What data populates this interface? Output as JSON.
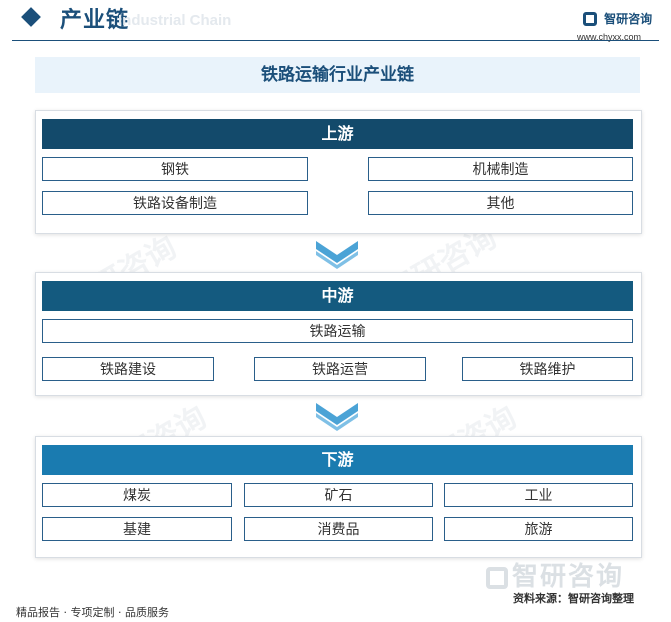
{
  "header": {
    "section_title": "产业链",
    "section_subtitle": "Industrial Chain",
    "brand_name": "智研咨询",
    "brand_url": "www.chyxx.com"
  },
  "title": "铁路运输行业产业链",
  "upstream": {
    "label": "上游",
    "items": [
      "钢铁",
      "机械制造",
      "铁路设备制造",
      "其他"
    ]
  },
  "midstream": {
    "label": "中游",
    "core": "铁路运输",
    "items": [
      "铁路建设",
      "铁路运营",
      "铁路维护"
    ]
  },
  "downstream": {
    "label": "下游",
    "items": [
      "煤炭",
      "矿石",
      "工业",
      "基建",
      "消费品",
      "旅游"
    ]
  },
  "footer": {
    "left": "精品报告 · 专项定制 · 品质服务",
    "source": "资料来源：智研咨询整理",
    "watermark": "智研咨询"
  },
  "colors": {
    "upstream_bar": "#134a6b",
    "midstream_bar": "#145a7f",
    "downstream_bar": "#1a7bb0",
    "arrow": "#4ba3d6",
    "accent": "#1b4f7a"
  },
  "icons": [
    "diamond-icon",
    "logo-icon",
    "arrow-down-icon"
  ]
}
